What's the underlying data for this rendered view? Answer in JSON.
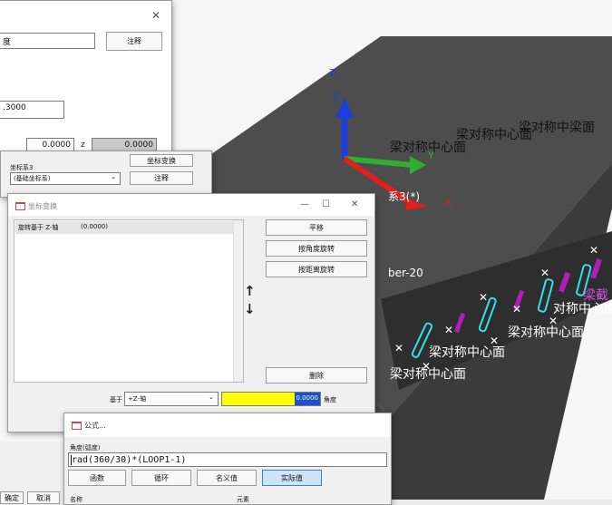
{
  "viewport": {
    "axis_z_label_1": "Z",
    "axis_z_label_2": "Z",
    "axis_y_label": "Y",
    "axis_x_label": "X",
    "coord_sys_label": "系3(*)",
    "beam_label": "ber-20",
    "sym_labels": [
      "梁对称中心面",
      "梁对称中心面",
      "梁对称中梁面",
      "梁对称中心面",
      "梁对称中心面",
      "梁对称中心面",
      "对称中心面",
      "梁截"
    ],
    "colors": {
      "sky": "#f6f6f6",
      "plane": "#4d4d4d",
      "dark": "#3a3a3a",
      "axis_z": "#1a3fdc",
      "axis_y": "#2fae32",
      "axis_x": "#e02020",
      "cyan": "#35e0ee",
      "magenta": "#b01db8"
    }
  },
  "dialog_back": {
    "close_glyph": "✕",
    "name_value": "度",
    "note_button": "注释",
    "unit_fragment": "",
    "value_field": ".3000",
    "value_right": "0.0000",
    "axis_label": "z",
    "value_right2": "0.0000"
  },
  "dialog_mid": {
    "coord_label": "坐标系3",
    "coord_transform_button": "坐标变换",
    "coord_select": "(基础坐标系)",
    "note_button": "注释"
  },
  "dialog_transform": {
    "title": "坐标变换",
    "title_buttons": [
      "—",
      "☐",
      "✕"
    ],
    "list_items": [
      {
        "name": "旋转基于 Z-轴",
        "value": "(0.0000)"
      }
    ],
    "buttons": [
      "平移",
      "按角度旋转",
      "按距离旋转"
    ],
    "delete_button": "删除",
    "base_label": "基于",
    "base_select": "+Z-轴",
    "angle_value": "0.0000",
    "angle_label": "角度",
    "arrow_up": "↑",
    "arrow_down": "↓"
  },
  "dialog_formula": {
    "title": "公式...",
    "field_label": "角度(弧度)",
    "formula_text": "rad(360/30)*(LOOP1-1)",
    "buttons": [
      "函数",
      "循环",
      "名义值",
      "实际值"
    ],
    "col_name": "名称",
    "col_value": "元素"
  },
  "bottom_left": {
    "btn1": "确定",
    "btn2": "取消"
  }
}
